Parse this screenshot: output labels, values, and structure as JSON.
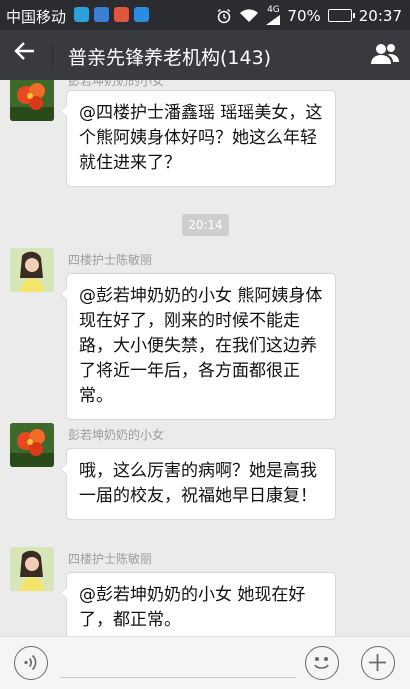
{
  "status_bar": {
    "carrier": "中国移动",
    "network": "4G",
    "battery": "70%",
    "battery_level": 0.7,
    "time": "20:37"
  },
  "header": {
    "title": "普亲先锋养老机构(143)",
    "back_icon": "arrow-left-icon",
    "members_icon": "group-members-icon"
  },
  "chat": {
    "timestamp": "20:14",
    "messages": [
      {
        "sender": "彭若坤奶奶的小女",
        "avatar": "flower-avatar",
        "text": "@四楼护士潘鑫瑶 瑶瑶美女，这个熊阿姨身体好吗？她这么年轻就住进来了？"
      },
      {
        "sender": "四楼护士陈敏丽",
        "avatar": "girl-avatar",
        "text": "@彭若坤奶奶的小女 熊阿姨身体现在好了，刚来的时候不能走路，大小便失禁，在我们这边养了将近一年后，各方面都很正常。"
      },
      {
        "sender": "彭若坤奶奶的小女",
        "avatar": "flower-avatar",
        "text": "哦，这么厉害的病啊？她是高我一届的校友，祝福她早日康复！"
      },
      {
        "sender": "四楼护士陈敏丽",
        "avatar": "girl-avatar",
        "text": "@彭若坤奶奶的小女 她现在好了，都正常。"
      }
    ]
  },
  "input_bar": {
    "voice_icon": "voice-icon",
    "emoji_icon": "emoji-icon",
    "plus_icon": "plus-icon"
  },
  "colors": {
    "titlebar": "#393a3f",
    "statusbar": "#2a2c30",
    "chat_background": "#ebebeb",
    "bubble": "#ffffff"
  }
}
